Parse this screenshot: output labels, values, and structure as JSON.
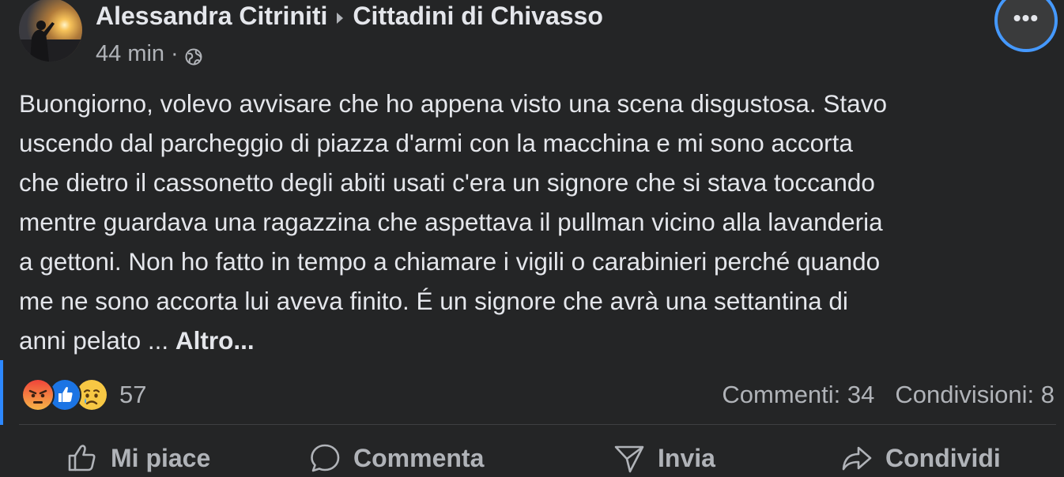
{
  "post": {
    "author": "Alessandra Citriniti",
    "group": "Cittadini di Chivasso",
    "time": "44 min",
    "meta_separator": "·",
    "privacy_icon": "globe-icon",
    "more_label": "•••",
    "body_lines": [
      "Buongiorno, volevo avvisare che ho appena visto una scena disgustosa. Stavo",
      "uscendo dal parcheggio di piazza d'armi con la macchina e mi sono accorta",
      "che dietro il cassonetto degli abiti usati c'era un signore che si stava toccando",
      "mentre guardava una ragazzina che aspettava il pullman vicino alla lavanderia",
      "a gettoni. Non ho fatto in tempo a chiamare i vigili o carabinieri perché quando",
      "me ne sono accorta lui aveva finito. É un signore che avrà una settantina di",
      "anni pelato ... "
    ],
    "see_more": "Altro..."
  },
  "stats": {
    "reactions": [
      "angry-reaction-icon",
      "like-reaction-icon",
      "sad-reaction-icon"
    ],
    "reaction_count": "57",
    "comments": "Commenti: 34",
    "shares": "Condivisioni: 8"
  },
  "actions": {
    "like": "Mi piace",
    "comment": "Commenta",
    "send": "Invia",
    "share": "Condividi"
  },
  "colors": {
    "background": "#242526",
    "text": "#e4e6eb",
    "secondary_text": "#b0b3b8",
    "accent": "#2d88ff"
  }
}
